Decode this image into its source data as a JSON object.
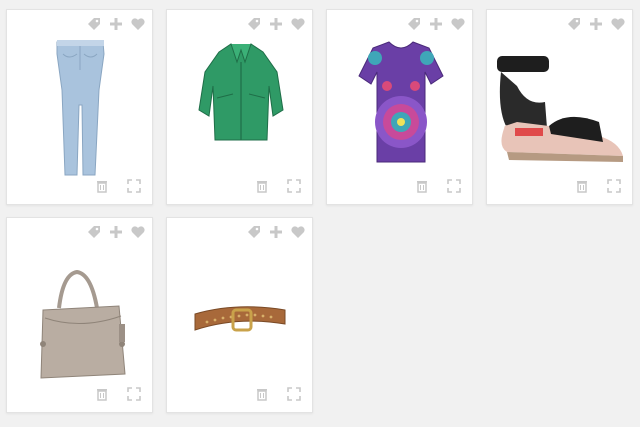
{
  "products": [
    {
      "id": "jeans",
      "icon": "jeans-image"
    },
    {
      "id": "jacket",
      "icon": "green-leather-jacket-image"
    },
    {
      "id": "top",
      "icon": "patterned-top-image"
    },
    {
      "id": "sandal",
      "icon": "sandal-image"
    },
    {
      "id": "bag",
      "icon": "handbag-image"
    },
    {
      "id": "belt",
      "icon": "belt-image"
    }
  ],
  "card_icons": {
    "tag": "tag-icon",
    "add": "plus-icon",
    "favorite": "heart-icon",
    "delete": "trash-icon",
    "expand": "expand-icon"
  },
  "colors": {
    "background": "#f1f1f1",
    "card": "#ffffff",
    "icon": "#c8c8c8"
  }
}
